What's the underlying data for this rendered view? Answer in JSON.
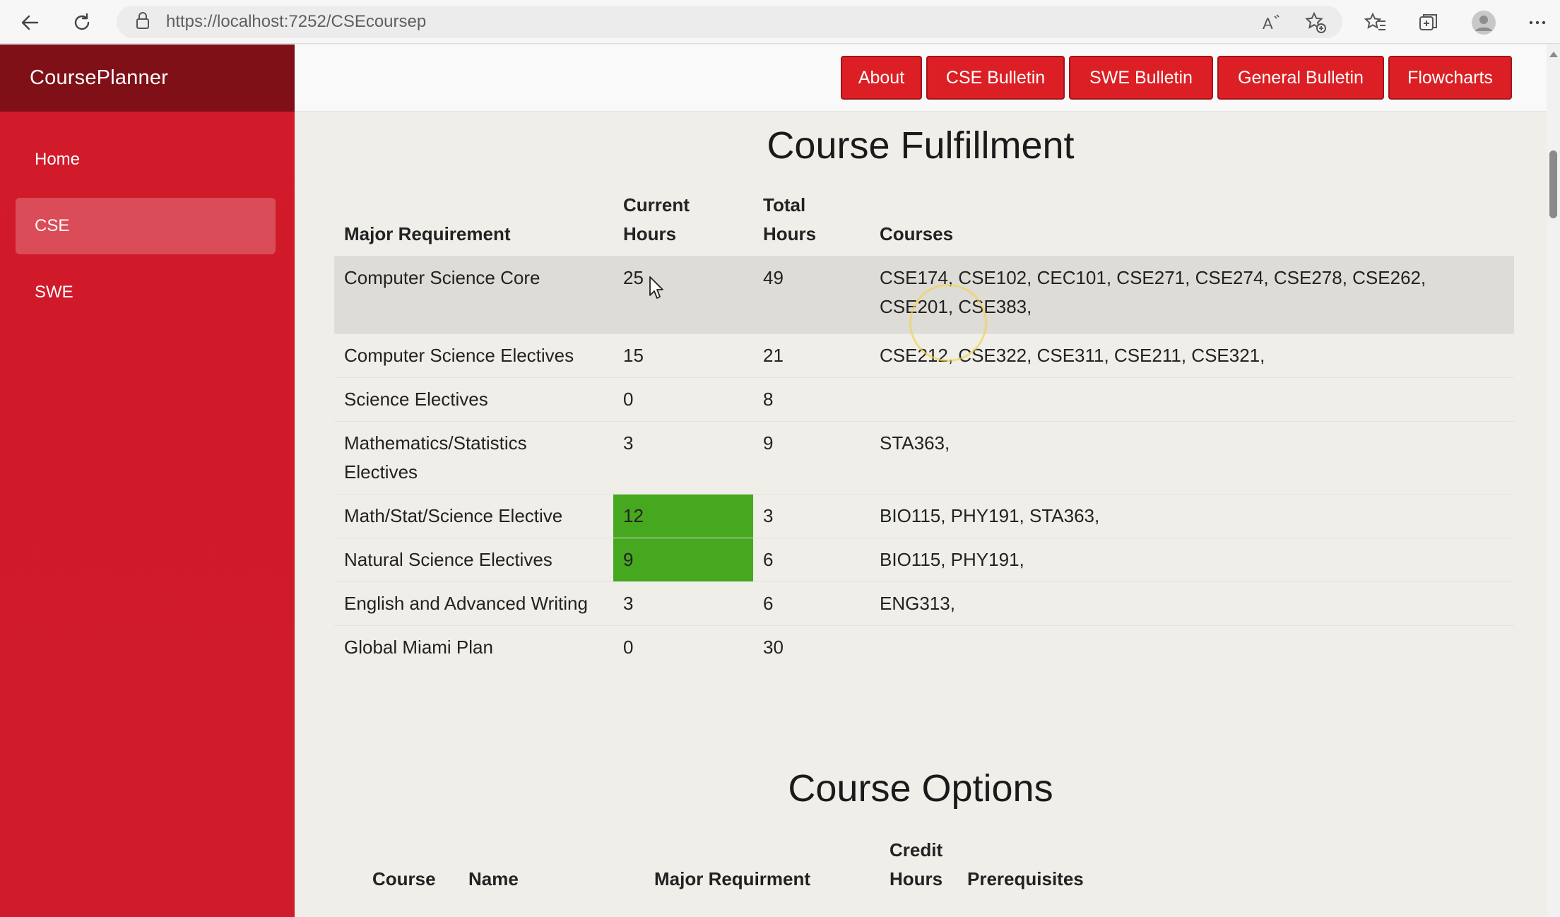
{
  "browser": {
    "url": "https://localhost:7252/CSEcoursep"
  },
  "sidebar": {
    "brand": "CoursePlanner",
    "items": [
      {
        "label": "Home"
      },
      {
        "label": "CSE",
        "active": true
      },
      {
        "label": "SWE"
      }
    ]
  },
  "topnav": {
    "buttons": [
      "About",
      "CSE Bulletin",
      "SWE Bulletin",
      "General Bulletin",
      "Flowcharts"
    ]
  },
  "fulfillment": {
    "title": "Course Fulfillment",
    "headers": {
      "requirement": "Major Requirement",
      "current_line1": "Current",
      "current_line2": "Hours",
      "total_line1": "Total",
      "total_line2": "Hours",
      "courses": "Courses"
    },
    "rows": [
      {
        "requirement": "Computer Science Core",
        "current": "25",
        "total": "49",
        "courses": "CSE174, CSE102, CEC101, CSE271, CSE274, CSE278, CSE262, CSE201, CSE383,"
      },
      {
        "requirement": "Computer Science Electives",
        "current": "15",
        "total": "21",
        "courses": "CSE212, CSE322, CSE311, CSE211, CSE321,"
      },
      {
        "requirement": "Science Electives",
        "current": "0",
        "total": "8",
        "courses": ""
      },
      {
        "requirement": "Mathematics/Statistics Electives",
        "current": "3",
        "total": "9",
        "courses": "STA363,"
      },
      {
        "requirement": "Math/Stat/Science Elective",
        "current": "12",
        "total": "3",
        "courses": "BIO115, PHY191, STA363,"
      },
      {
        "requirement": "Natural Science Electives",
        "current": "9",
        "total": "6",
        "courses": "BIO115, PHY191,"
      },
      {
        "requirement": "English and Advanced Writing",
        "current": "3",
        "total": "6",
        "courses": "ENG313,"
      },
      {
        "requirement": "Global Miami Plan",
        "current": "0",
        "total": "30",
        "courses": ""
      }
    ],
    "exceeded_color": "#46a81e"
  },
  "options": {
    "title": "Course Options",
    "headers": {
      "course": "Course",
      "name": "Name",
      "requirement": "Major Requirment",
      "credit_line1": "Credit",
      "credit_line2": "Hours",
      "prereqs": "Prerequisites"
    }
  },
  "colors": {
    "sidebar": "#d11a2a",
    "brand_bar": "#7f1018",
    "button": "#dc1f24"
  },
  "icons": {
    "back": "arrow-left-icon",
    "refresh": "refresh-icon",
    "lock": "lock-icon",
    "read_aloud": "read-aloud-icon",
    "add_favorite": "star-plus-icon",
    "favorites": "favorites-icon",
    "collections": "collections-icon",
    "profile": "avatar-icon",
    "more": "more-icon"
  }
}
